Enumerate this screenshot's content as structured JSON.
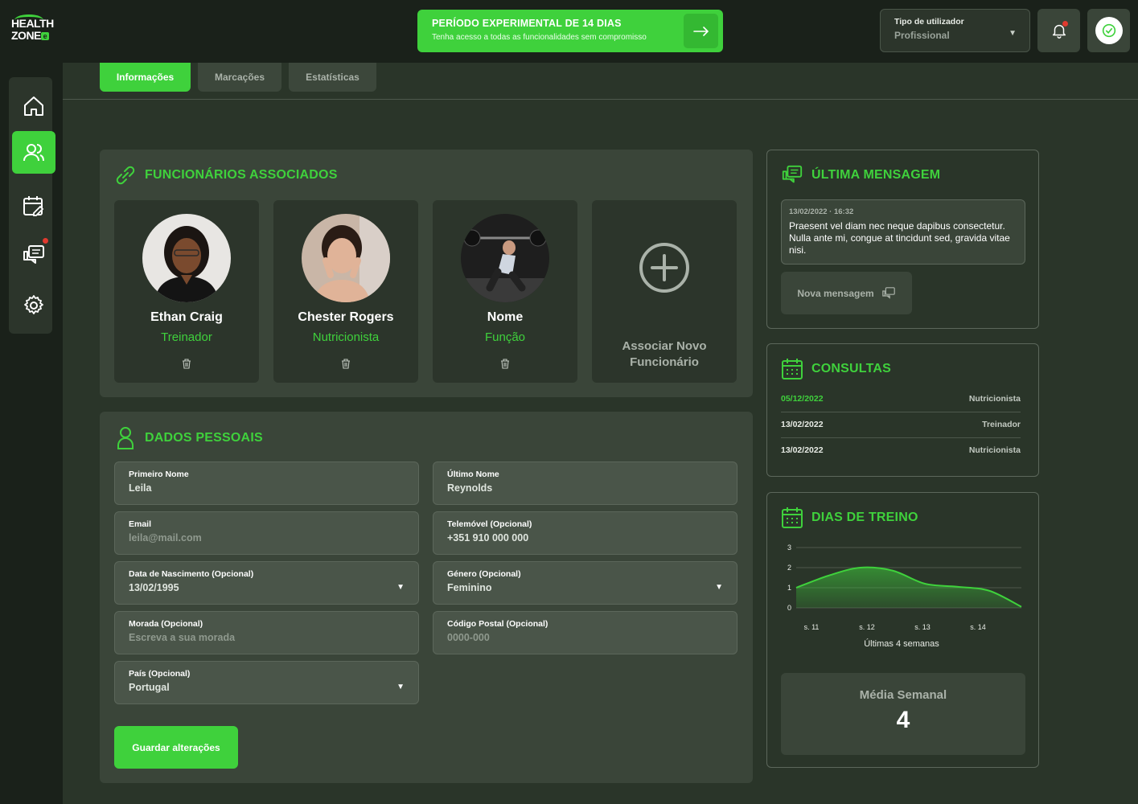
{
  "brand": {
    "line1": "HEALTH",
    "line2": "ZONE",
    "badge": "e"
  },
  "trial": {
    "title": "PERÍODO EXPERIMENTAL DE 14 DIAS",
    "subtitle": "Tenha acesso a todas as funcionalidades sem compromisso"
  },
  "user_type": {
    "label": "Tipo de utilizador",
    "value": "Profissional"
  },
  "tabs": [
    {
      "label": "Informações",
      "active": true
    },
    {
      "label": "Marcações",
      "active": false
    },
    {
      "label": "Estatísticas",
      "active": false
    }
  ],
  "employees": {
    "title": "FUNCIONÁRIOS ASSOCIADOS",
    "items": [
      {
        "name": "Ethan Craig",
        "role": "Treinador"
      },
      {
        "name": "Chester Rogers",
        "role": "Nutricionista"
      },
      {
        "name": "Nome",
        "role": "Função"
      }
    ],
    "add_line1": "Associar Novo",
    "add_line2": "Funcionário"
  },
  "personal": {
    "title": "DADOS PESSOAIS",
    "first_name": {
      "label": "Primeiro Nome",
      "value": "Leila"
    },
    "last_name": {
      "label": "Último Nome",
      "value": "Reynolds"
    },
    "email": {
      "label": "Email",
      "value": "leila@mail.com"
    },
    "phone": {
      "label": "Telemóvel (Opcional)",
      "value": "+351 910 000 000"
    },
    "birthdate": {
      "label": "Data de Nascimento (Opcional)",
      "value": "13/02/1995"
    },
    "gender": {
      "label": "Género (Opcional)",
      "value": "Feminino"
    },
    "address": {
      "label": "Morada (Opcional)",
      "placeholder": "Escreva a sua morada"
    },
    "postal": {
      "label": "Código Postal (Opcional)",
      "placeholder": "0000-000"
    },
    "country": {
      "label": "País (Opcional)",
      "value": "Portugal"
    },
    "save_label": "Guardar alterações"
  },
  "last_message": {
    "title": "ÚLTIMA MENSAGEM",
    "date": "13/02/2022 · 16:32",
    "text": "Praesent vel diam nec neque dapibus consectetur. Nulla ante mi, congue at tincidunt sed, gravida vitae nisi.",
    "new_label": "Nova mensagem"
  },
  "consultations": {
    "title": "CONSULTAS",
    "rows": [
      {
        "date": "05/12/2022",
        "type": "Nutricionista",
        "highlight": true
      },
      {
        "date": "13/02/2022",
        "type": "Treinador",
        "highlight": false
      },
      {
        "date": "13/02/2022",
        "type": "Nutricionista",
        "highlight": false
      }
    ]
  },
  "training": {
    "title": "DIAS DE TREINO",
    "avg_label": "Média Semanal",
    "avg_value": "4"
  },
  "chart_data": {
    "type": "area",
    "categories": [
      "s. 11",
      "s. 12",
      "s. 13",
      "s. 14"
    ],
    "x": [
      0,
      0.5,
      1,
      1.5,
      2,
      2.5,
      3,
      3.5
    ],
    "values": [
      1.0,
      1.6,
      2.0,
      1.85,
      1.2,
      1.05,
      0.85,
      0.05
    ],
    "xlabel": "Últimas 4 semanas",
    "ylabel": "",
    "ylim": [
      0,
      3
    ],
    "yticks": [
      "0",
      "1",
      "2",
      "3"
    ],
    "grid": true,
    "color": "#3fd13c"
  },
  "colors": {
    "accent": "#3fd13c",
    "background": "#2a3529",
    "panel": "#3a4539",
    "dark": "#1a211a"
  }
}
